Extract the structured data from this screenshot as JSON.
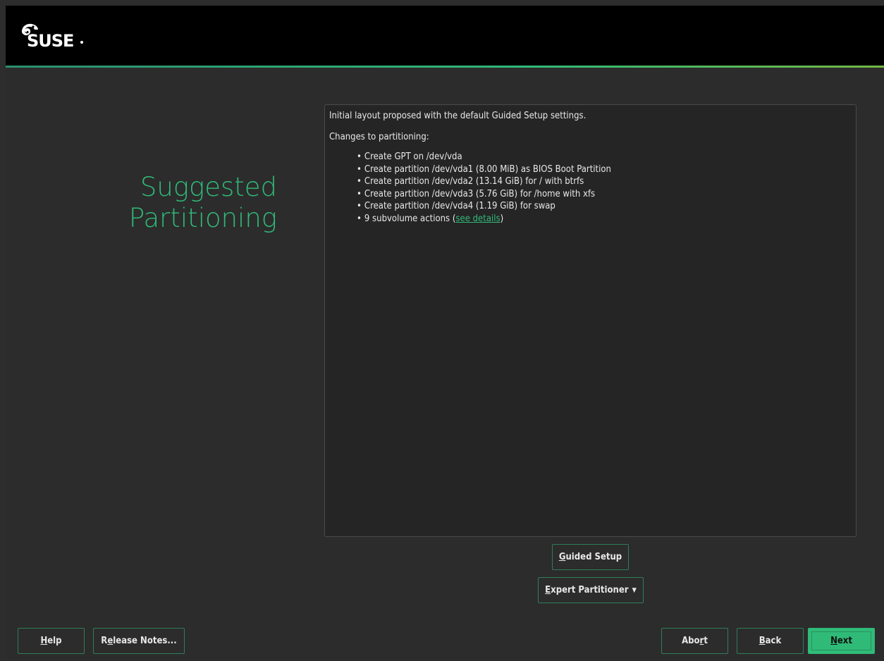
{
  "window": {
    "brand": "SUSE"
  },
  "page": {
    "title_line1": "Suggested",
    "title_line2": "Partitioning"
  },
  "summary": {
    "intro": "Initial layout proposed with the default Guided Setup settings.",
    "changes_heading": "Changes to partitioning:",
    "changes": [
      "Create GPT on /dev/vda",
      "Create partition /dev/vda1 (8.00 MiB) as BIOS Boot Partition",
      "Create partition /dev/vda2 (13.14 GiB) for / with btrfs",
      "Create partition /dev/vda3 (5.76 GiB) for /home with xfs",
      "Create partition /dev/vda4 (1.19 GiB) for swap"
    ],
    "subvolume_prefix": "9 subvolume actions (",
    "subvolume_link": "see details",
    "subvolume_suffix": ")"
  },
  "actions": {
    "guided_setup": {
      "mnemonic": "G",
      "rest": "uided Setup"
    },
    "expert_partitioner": {
      "mnemonic": "E",
      "rest": "xpert Partitioner"
    }
  },
  "footer": {
    "help": {
      "mnemonic": "H",
      "rest": "elp"
    },
    "release_notes": {
      "pre": "R",
      "mnemonic": "e",
      "rest": "lease Notes..."
    },
    "abort": {
      "pre": "Abo",
      "mnemonic": "r",
      "rest": "t"
    },
    "back": {
      "mnemonic": "B",
      "rest": "ack"
    },
    "next": {
      "mnemonic": "N",
      "rest": "ext"
    }
  },
  "colors": {
    "accent": "#30ba78",
    "header_bg": "#000000",
    "window_bg": "#2c2c2c",
    "panel_bg": "#252525"
  },
  "icons": {
    "logo": "suse-chameleon-logo",
    "dropdown": "caret-down-icon"
  }
}
